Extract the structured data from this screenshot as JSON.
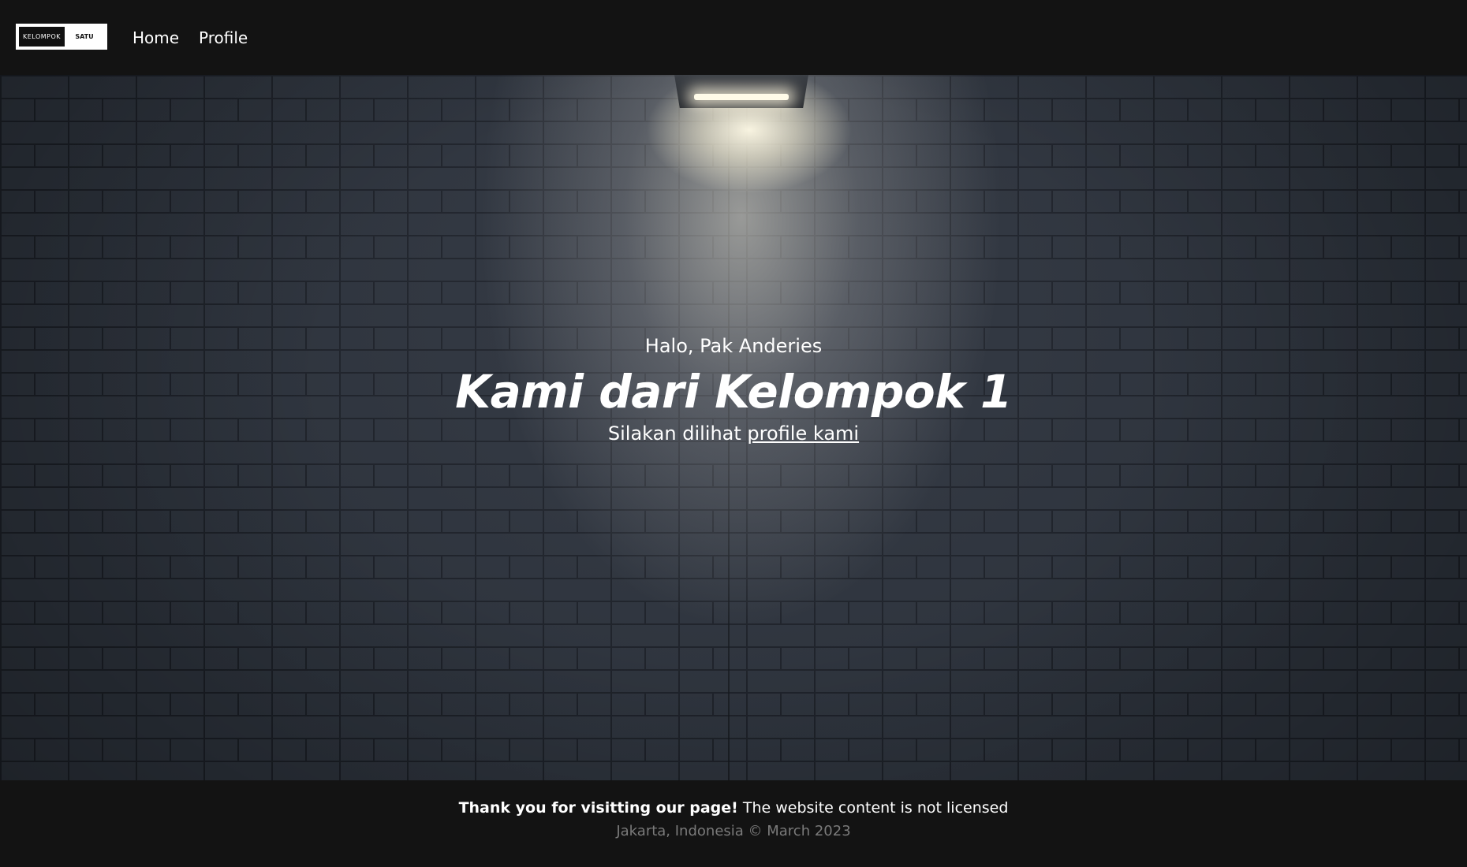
{
  "nav": {
    "logo_left": "KELOMPOK",
    "logo_right": "SATU",
    "home_label": "Home",
    "profile_label": "Profile"
  },
  "hero": {
    "greeting": "Halo, Pak Anderies",
    "headline": "Kami dari Kelompok 1",
    "sub_prefix": "Silakan dilihat ",
    "sub_link": "profile kami"
  },
  "footer": {
    "thanks_bold": "Thank you for visitting our page!",
    "thanks_rest": " The website content is not licensed",
    "location_date": "Jakarta, Indonesia © March 2023"
  }
}
